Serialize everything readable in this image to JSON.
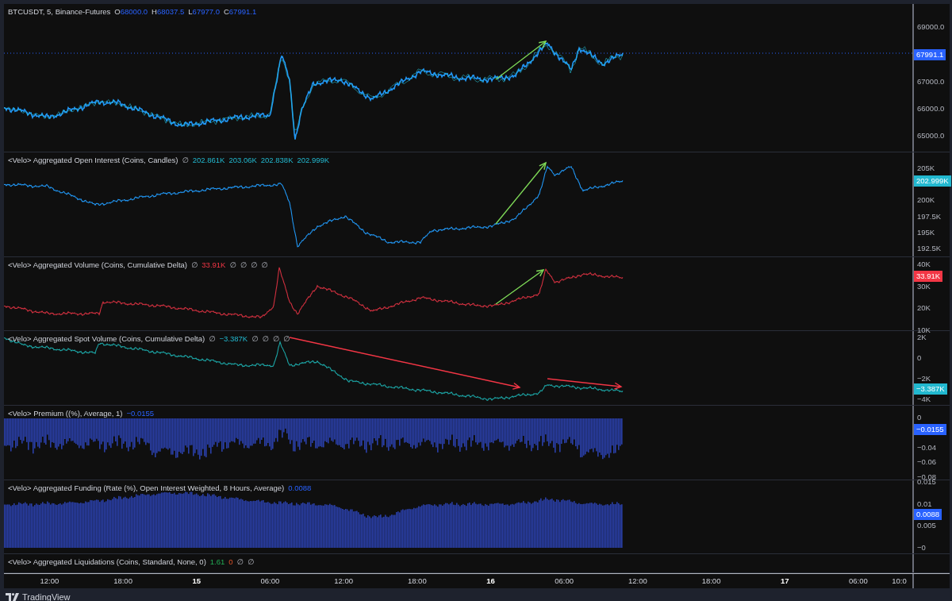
{
  "panes": [
    {
      "kind": "price",
      "legend": {
        "title": "BTCUSDT, 5, Binance-Futures",
        "values": [
          {
            "prefix": "O",
            "text": "68000.0",
            "kind": "series"
          },
          {
            "prefix": "H",
            "text": "68037.5",
            "kind": "series"
          },
          {
            "prefix": "L",
            "text": "67977.0",
            "kind": "series"
          },
          {
            "prefix": "C",
            "text": "67991.1",
            "kind": "series"
          }
        ]
      },
      "axis": {
        "ticks": [
          "69000.0",
          "67000.0",
          "66000.0",
          "65000.0"
        ],
        "last_value": {
          "text": "67991.1",
          "color": "#2962ff"
        }
      }
    },
    {
      "kind": "line",
      "legend": {
        "title": "<Velo> Aggregated Open Interest (Coins, Candles)",
        "values": [
          {
            "text": "∅",
            "kind": "empty"
          },
          {
            "text": "202.861K",
            "kind": "series"
          },
          {
            "text": "203.06K",
            "kind": "series"
          },
          {
            "text": "202.838K",
            "kind": "series"
          },
          {
            "text": "202.999K",
            "kind": "series"
          }
        ]
      },
      "axis": {
        "ticks": [
          "205K",
          "200K",
          "197.5K",
          "195K",
          "192.5K"
        ],
        "last_value": {
          "text": "202.999K",
          "color": "#22b8cf"
        }
      }
    },
    {
      "kind": "line",
      "legend": {
        "title": "<Velo> Aggregated Volume (Coins, Cumulative Delta)",
        "values": [
          {
            "text": "∅",
            "kind": "empty"
          },
          {
            "text": "33.91K",
            "kind": "series"
          },
          {
            "text": "∅",
            "kind": "empty"
          },
          {
            "text": "∅",
            "kind": "empty"
          },
          {
            "text": "∅",
            "kind": "empty"
          },
          {
            "text": "∅",
            "kind": "empty"
          }
        ]
      },
      "axis": {
        "ticks": [
          "40K",
          "30K",
          "20K",
          "10K"
        ],
        "last_value": {
          "text": "33.91K",
          "color": "#f23645"
        }
      }
    },
    {
      "kind": "line",
      "legend": {
        "title": "<Velo> Aggregated Spot Volume (Coins, Cumulative Delta)",
        "values": [
          {
            "text": "∅",
            "kind": "empty"
          },
          {
            "text": "−3.387K",
            "kind": "series"
          },
          {
            "text": "∅",
            "kind": "empty"
          },
          {
            "text": "∅",
            "kind": "empty"
          },
          {
            "text": "∅",
            "kind": "empty"
          },
          {
            "text": "∅",
            "kind": "empty"
          }
        ]
      },
      "axis": {
        "ticks": [
          "2K",
          "0",
          "−2K",
          "−4K"
        ],
        "last_value": {
          "text": "−3.387K",
          "color": "#22b8cf"
        }
      }
    },
    {
      "kind": "bars_down",
      "legend": {
        "title": "<Velo> Premium ((%), Average, 1)",
        "values": [
          {
            "text": "−0.0155",
            "kind": "series"
          }
        ]
      },
      "axis": {
        "ticks": [
          "0",
          "−0.04",
          "−0.06",
          "−0.08"
        ],
        "last_value": {
          "text": "−0.0155",
          "color": "#2962ff"
        }
      }
    },
    {
      "kind": "bars_up",
      "legend": {
        "title": "<Velo> Aggregated Funding (Rate (%), Open Interest Weighted, 8 Hours, Average)",
        "values": [
          {
            "text": "0.0088",
            "kind": "series"
          }
        ]
      },
      "axis": {
        "ticks": [
          "0.015",
          "0.01",
          "0.005",
          "−0"
        ],
        "last_value": {
          "text": "0.0088",
          "color": "#2962ff"
        }
      }
    },
    {
      "kind": "empty",
      "legend": {
        "title": "<Velo> Aggregated Liquidations (Coins, Standard, None, 0)",
        "values": [
          {
            "text": "1.61",
            "kind": "positive"
          },
          {
            "text": "0",
            "kind": "negative"
          },
          {
            "text": "∅",
            "kind": "empty"
          },
          {
            "text": "∅",
            "kind": "empty"
          }
        ]
      }
    }
  ],
  "time_axis": [
    {
      "text": "12:00",
      "kind": "time"
    },
    {
      "text": "18:00",
      "kind": "time"
    },
    {
      "text": "15",
      "kind": "day"
    },
    {
      "text": "06:00",
      "kind": "time"
    },
    {
      "text": "12:00",
      "kind": "time"
    },
    {
      "text": "18:00",
      "kind": "time"
    },
    {
      "text": "16",
      "kind": "day"
    },
    {
      "text": "06:00",
      "kind": "time"
    },
    {
      "text": "12:00",
      "kind": "time"
    },
    {
      "text": "18:00",
      "kind": "time"
    },
    {
      "text": "17",
      "kind": "day"
    },
    {
      "text": "06:00",
      "kind": "time"
    },
    {
      "text": "10:0",
      "kind": "time"
    }
  ],
  "branding": "TradingView"
}
